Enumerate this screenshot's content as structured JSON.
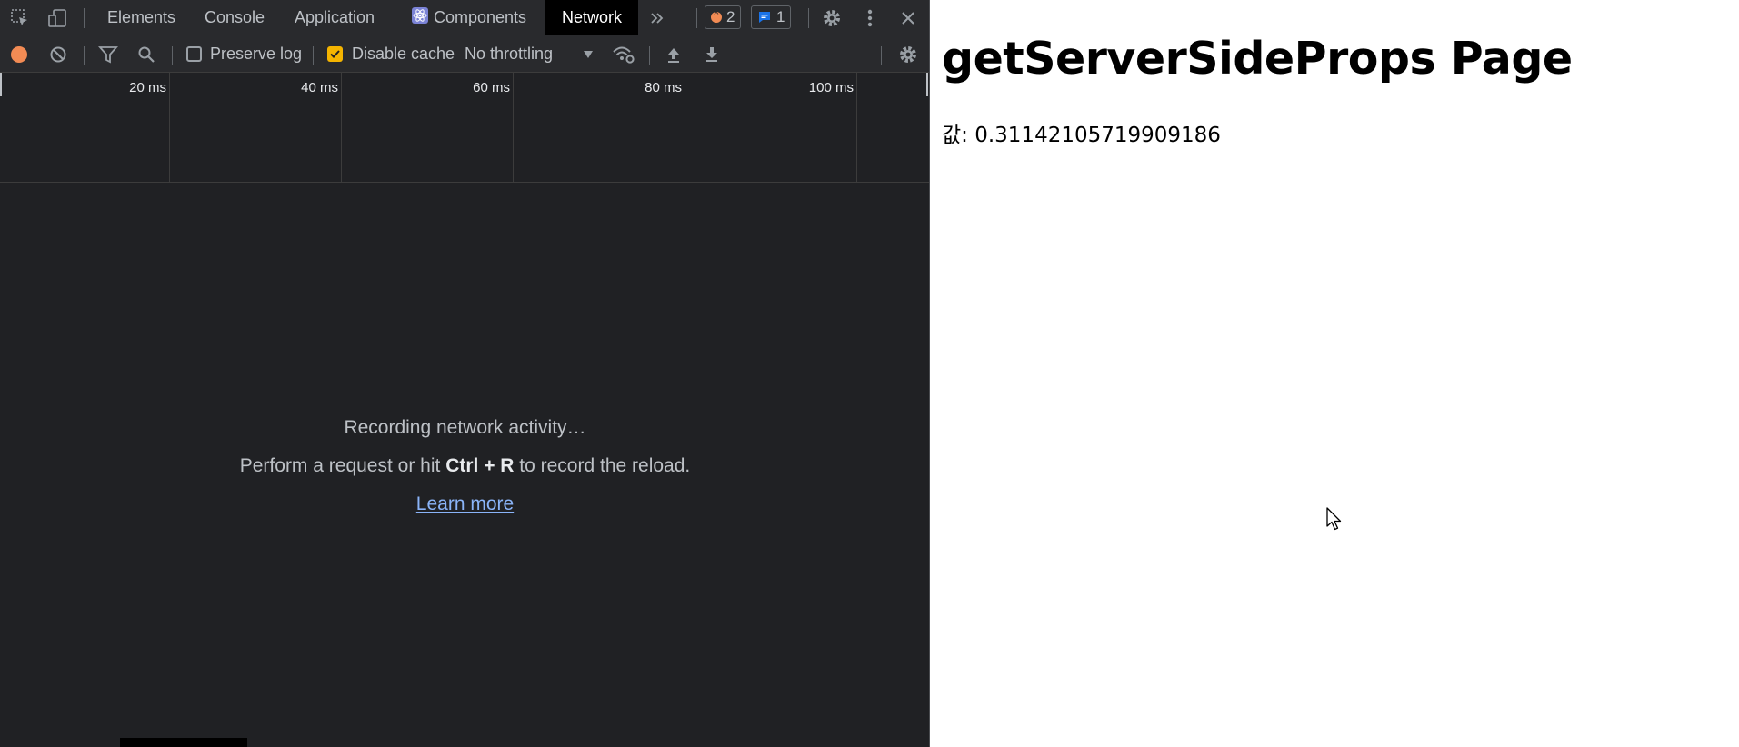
{
  "devtools": {
    "tabs": [
      {
        "label": "Elements"
      },
      {
        "label": "Console"
      },
      {
        "label": "Application"
      },
      {
        "label": "Components"
      },
      {
        "label": "Network"
      }
    ],
    "active_tab": "Network",
    "error_count": "2",
    "message_count": "1",
    "toolbar": {
      "preserve_log": {
        "label": "Preserve log",
        "checked": false
      },
      "disable_cache": {
        "label": "Disable cache",
        "checked": true
      },
      "throttling": "No throttling"
    },
    "timeline": {
      "ticks": [
        "20 ms",
        "40 ms",
        "60 ms",
        "80 ms",
        "100 ms"
      ]
    },
    "empty_state": {
      "title": "Recording network activity…",
      "hint_prefix": "Perform a request or hit ",
      "hint_keys": "Ctrl + R",
      "hint_suffix": " to record the reload.",
      "link": "Learn more"
    },
    "colors": {
      "record": "#f28b54",
      "checkbox_on": "#f4b400",
      "link": "#8ab4f8"
    }
  },
  "page": {
    "title": "getServerSideProps Page",
    "value_label": "값: 0.31142105719909186"
  }
}
